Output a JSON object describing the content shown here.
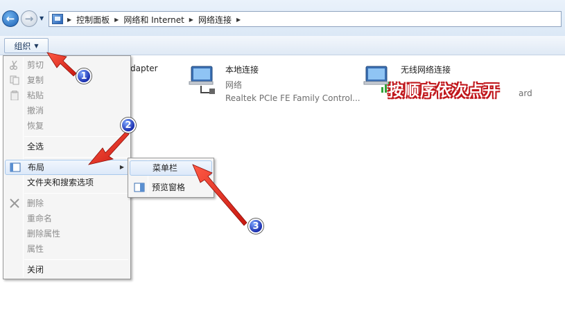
{
  "breadcrumb": [
    "控制面板",
    "网络和 Internet",
    "网络连接"
  ],
  "toolbar": {
    "organize_label": "组织"
  },
  "connections": [
    {
      "name": "dapter",
      "status": "",
      "device": ""
    },
    {
      "name": "本地连接",
      "status": "网络",
      "device": "Realtek PCIe FE Family Control..."
    },
    {
      "name": "无线网络连接",
      "status": "",
      "device": "ard"
    }
  ],
  "overlay_text": "按顺序依次点开",
  "organize_menu": {
    "items": [
      {
        "label": "剪切",
        "enabled": false,
        "icon": "scissors-icon"
      },
      {
        "label": "复制",
        "enabled": false,
        "icon": "copy-icon"
      },
      {
        "label": "粘贴",
        "enabled": false,
        "icon": "paste-icon"
      },
      {
        "label": "撤消",
        "enabled": false
      },
      {
        "label": "恢复",
        "enabled": false
      },
      {
        "label": "全选",
        "enabled": true
      },
      {
        "label": "布局",
        "enabled": true,
        "icon": "layout-icon",
        "submenu": true,
        "highlighted": true
      },
      {
        "label": "文件夹和搜索选项",
        "enabled": true
      },
      {
        "label": "删除",
        "enabled": false,
        "icon": "delete-x-icon"
      },
      {
        "label": "重命名",
        "enabled": false
      },
      {
        "label": "删除属性",
        "enabled": false
      },
      {
        "label": "属性",
        "enabled": false
      },
      {
        "label": "关闭",
        "enabled": true
      }
    ]
  },
  "layout_submenu": {
    "items": [
      {
        "label": "菜单栏",
        "highlighted": true
      },
      {
        "label": "预览窗格",
        "icon": "preview-pane-icon"
      }
    ]
  },
  "badges": [
    "1",
    "2",
    "3"
  ],
  "colors": {
    "arrow_red": "#e8281e",
    "badge_blue": "#1b2fae",
    "overlay_outline": "#c0161b"
  }
}
